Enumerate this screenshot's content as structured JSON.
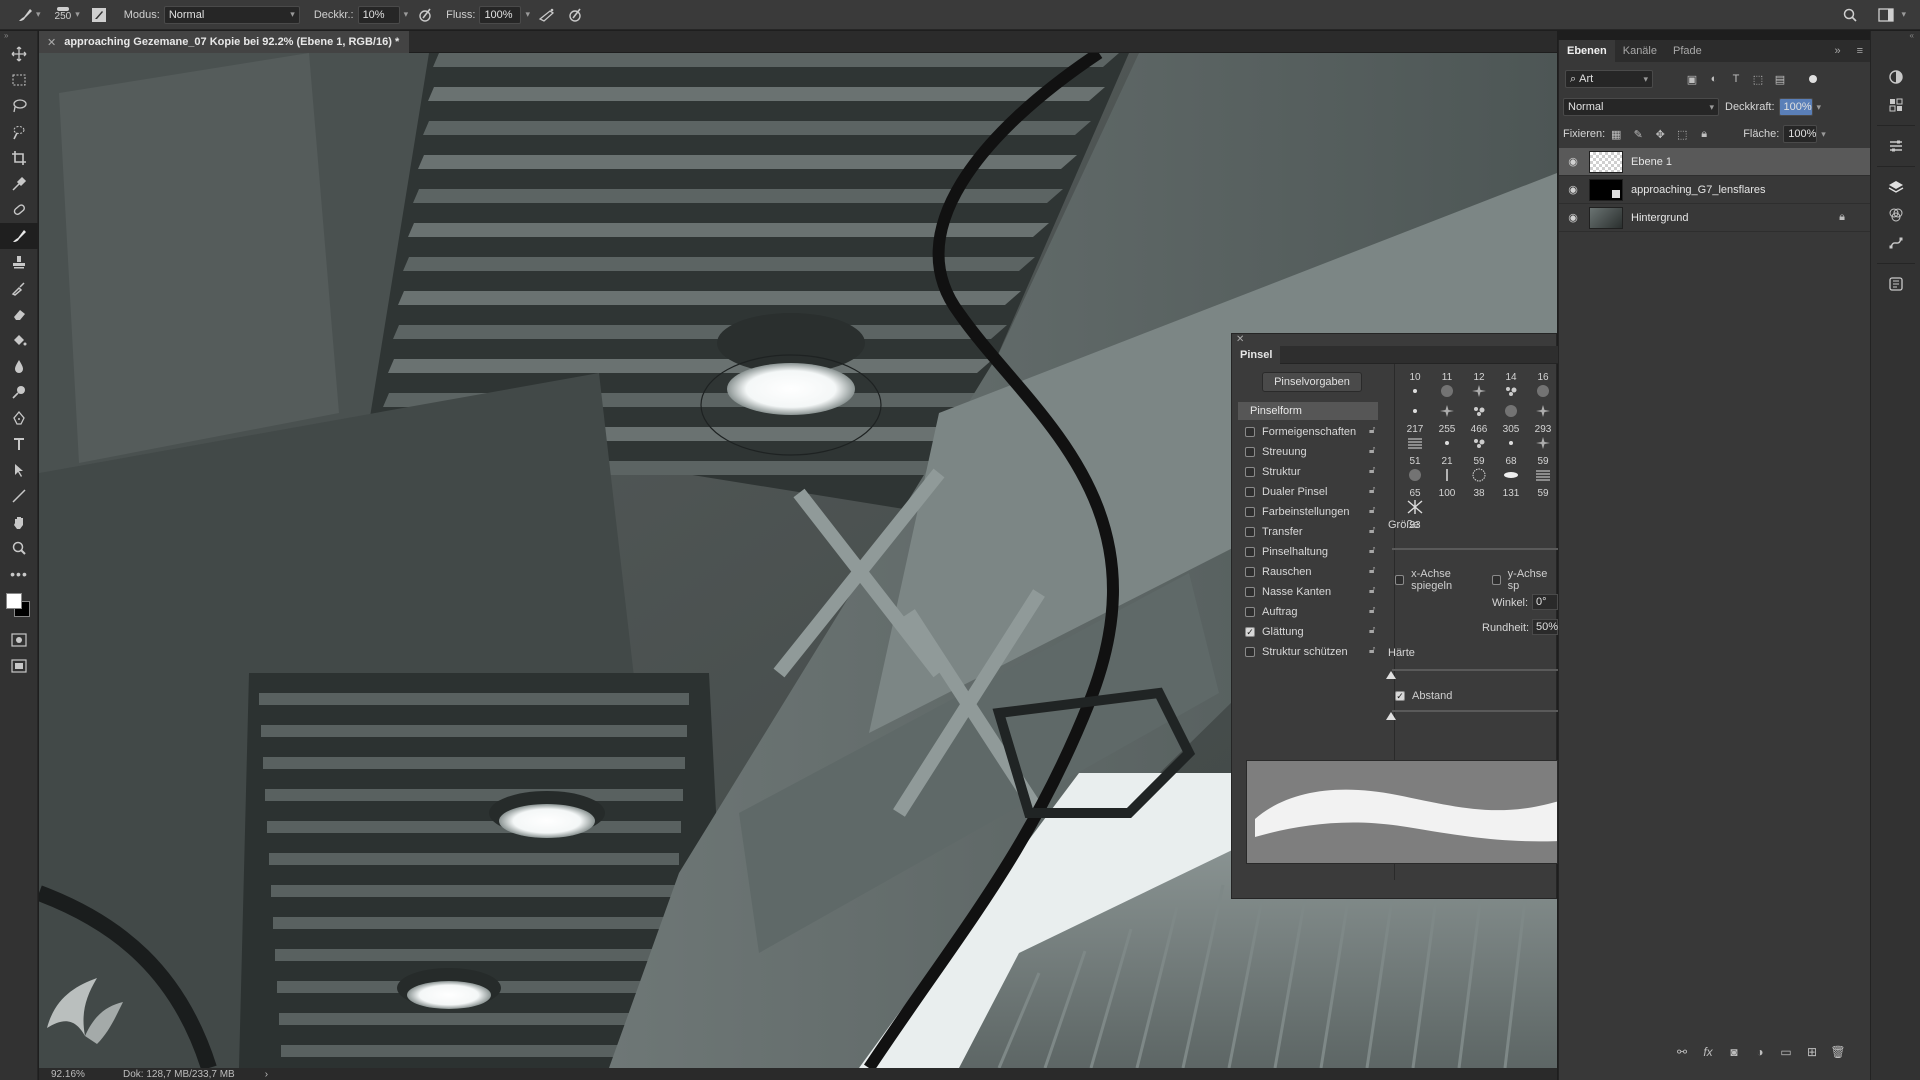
{
  "options_bar": {
    "brush_size": "250",
    "mode_label": "Modus:",
    "mode_value": "Normal",
    "opacity_label": "Deckkr.:",
    "opacity_value": "10%",
    "flow_label": "Fluss:",
    "flow_value": "100%"
  },
  "document": {
    "tab_title": "approaching Gezemane_07 Kopie bei 92.2% (Ebene 1, RGB/16) *"
  },
  "status_bar": {
    "zoom": "92.16%",
    "doc_size": "Dok: 128,7 MB/233,7 MB"
  },
  "brush_panel": {
    "title": "Pinsel",
    "presets_button": "Pinselvorgaben",
    "section_header": "Pinselform",
    "options": [
      {
        "label": "Formeigenschaften",
        "checked": false
      },
      {
        "label": "Streuung",
        "checked": false
      },
      {
        "label": "Struktur",
        "checked": false
      },
      {
        "label": "Dualer Pinsel",
        "checked": false
      },
      {
        "label": "Farbeinstellungen",
        "checked": false
      },
      {
        "label": "Transfer",
        "checked": false
      },
      {
        "label": "Pinselhaltung",
        "checked": false
      },
      {
        "label": "Rauschen",
        "checked": false
      },
      {
        "label": "Nasse Kanten",
        "checked": false
      },
      {
        "label": "Auftrag",
        "checked": false
      },
      {
        "label": "Glättung",
        "checked": true
      },
      {
        "label": "Struktur schützen",
        "checked": false
      }
    ],
    "tip_sizes": [
      "10",
      "11",
      "12",
      "14",
      "16",
      "217",
      "255",
      "466",
      "305",
      "293",
      "51",
      "21",
      "59",
      "68",
      "59",
      "65",
      "100",
      "38",
      "131",
      "59",
      "33"
    ],
    "size_label": "Größe",
    "flip_x_label": "x-Achse spiegeln",
    "flip_y_label": "y-Achse sp",
    "angle_label": "Winkel:",
    "angle_value": "0°",
    "roundness_label": "Rundheit:",
    "roundness_value": "50%",
    "hardness_label": "Härte",
    "spacing_label": "Abstand"
  },
  "layers_panel": {
    "tabs": [
      "Ebenen",
      "Kanäle",
      "Pfade"
    ],
    "filter_value": "Art",
    "blend_mode": "Normal",
    "opacity_label": "Deckkraft:",
    "opacity_value": "100%",
    "lock_label": "Fixieren:",
    "fill_label": "Fläche:",
    "fill_value": "100%",
    "layers": [
      {
        "name": "Ebene 1",
        "selected": true,
        "locked": false
      },
      {
        "name": "approaching_G7_lensflares",
        "selected": false,
        "locked": false
      },
      {
        "name": "Hintergrund",
        "selected": false,
        "locked": true
      }
    ]
  },
  "icons": {
    "brush_tool": "brush-icon",
    "search": "search-icon",
    "workspace": "workspace-icon"
  },
  "colors": {
    "foreground": "#ffffff",
    "background": "#000000",
    "ui_dark": "#323232",
    "panel": "#3b3b3b"
  }
}
